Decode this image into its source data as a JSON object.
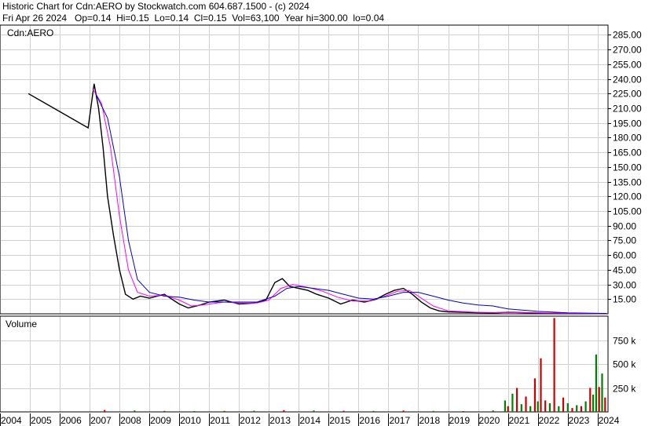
{
  "header": {
    "title_line": "Historic Chart for Cdn:AERO by Stockwatch.com 604.687.1500 - (c) 2024",
    "quote_line": "Fri Apr 26 2024   Op=0.14  Hi=0.15  Lo=0.14  Cl=0.15  Vol=63,100  Year hi=300.00  lo=0.04"
  },
  "chart_data": [
    {
      "type": "candlestick",
      "symbol_label": "Cdn:AERO",
      "ylim": [
        0,
        295
      ],
      "y_ticks": [
        "15.00",
        "30.00",
        "45.00",
        "60.00",
        "75.00",
        "90.00",
        "105.00",
        "120.00",
        "135.00",
        "150.00",
        "165.00",
        "180.00",
        "195.00",
        "210.00",
        "225.00",
        "240.00",
        "255.00",
        "270.00",
        "285.00"
      ],
      "grid": true,
      "series": [
        {
          "key": "price",
          "color": "#000000",
          "x": [
            2004.95,
            2006.95,
            2007.15,
            2007.3,
            2007.45,
            2007.6,
            2007.8,
            2008.0,
            2008.2,
            2008.45,
            2008.7,
            2009.0,
            2009.5,
            2010.0,
            2010.3,
            2010.7,
            2011.0,
            2011.5,
            2012.0,
            2012.5,
            2012.9,
            2013.2,
            2013.45,
            2013.7,
            2014.0,
            2014.3,
            2014.6,
            2015.0,
            2015.4,
            2015.8,
            2016.2,
            2016.6,
            2016.9,
            2017.2,
            2017.5,
            2017.8,
            2018.1,
            2018.4,
            2018.7,
            2019.0,
            2019.5,
            2020.0,
            2020.5,
            2021.0,
            2021.5,
            2022.0,
            2022.5,
            2023.0,
            2023.5,
            2024.0,
            2024.3
          ],
          "y": [
            225,
            190,
            235,
            210,
            170,
            120,
            80,
            45,
            20,
            15,
            18,
            16,
            20,
            10,
            6,
            9,
            12,
            14,
            10,
            11,
            14,
            32,
            36,
            28,
            26,
            24,
            20,
            16,
            10,
            14,
            12,
            15,
            20,
            24,
            26,
            20,
            12,
            6,
            3,
            2,
            1.5,
            1.2,
            1.0,
            1.5,
            1.2,
            0.8,
            0.6,
            0.5,
            0.3,
            0.2,
            0.15
          ]
        },
        {
          "key": "ma_short",
          "color": "#ff00ff",
          "x": [
            2007.1,
            2007.4,
            2007.7,
            2008.0,
            2008.3,
            2008.6,
            2009.0,
            2009.5,
            2010.0,
            2010.4,
            2010.8,
            2011.5,
            2012.0,
            2012.6,
            2013.0,
            2013.4,
            2013.8,
            2014.3,
            2014.8,
            2015.3,
            2015.8,
            2016.3,
            2016.8,
            2017.3,
            2017.7,
            2018.1,
            2018.5,
            2019.0,
            2020.0,
            2021.0,
            2022.0,
            2023.0,
            2024.3
          ],
          "y": [
            230,
            215,
            170,
            100,
            45,
            22,
            18,
            19,
            14,
            8,
            9,
            12,
            11,
            11,
            14,
            26,
            30,
            27,
            23,
            17,
            13,
            13,
            17,
            23,
            24,
            16,
            8,
            3,
            1.5,
            1.3,
            0.9,
            0.5,
            0.2
          ]
        },
        {
          "key": "ma_long",
          "color": "#0000cc",
          "x": [
            2007.2,
            2007.6,
            2008.0,
            2008.3,
            2008.6,
            2009.0,
            2009.5,
            2010.0,
            2010.5,
            2011.0,
            2011.5,
            2012.0,
            2012.6,
            2013.2,
            2013.6,
            2014.0,
            2014.5,
            2015.0,
            2015.5,
            2016.0,
            2016.5,
            2017.0,
            2017.5,
            2018.0,
            2018.5,
            2019.0,
            2019.5,
            2020.0,
            2020.5,
            2021.0,
            2022.0,
            2023.0,
            2024.3
          ],
          "y": [
            225,
            200,
            140,
            75,
            35,
            22,
            18,
            17,
            14,
            12,
            12,
            12,
            12,
            18,
            26,
            28,
            26,
            24,
            20,
            16,
            15,
            18,
            22,
            22,
            18,
            14,
            11,
            9,
            8,
            5,
            2.5,
            1,
            0.4
          ]
        }
      ]
    },
    {
      "type": "bar",
      "title": "Volume",
      "ylim": [
        0,
        1000
      ],
      "y_ticks": [
        "250 k",
        "500 k",
        "750 k"
      ],
      "grid": true,
      "x": [
        2007.5,
        2008.5,
        2009.5,
        2010.5,
        2011.5,
        2012.5,
        2013.5,
        2014.5,
        2015.5,
        2016.5,
        2017.5,
        2018.5,
        2019.5,
        2020.5,
        2020.9,
        2021.0,
        2021.15,
        2021.3,
        2021.45,
        2021.6,
        2021.75,
        2021.9,
        2022.0,
        2022.1,
        2022.25,
        2022.4,
        2022.55,
        2022.7,
        2022.85,
        2023.0,
        2023.15,
        2023.3,
        2023.45,
        2023.6,
        2023.75,
        2023.85,
        2023.95,
        2024.05,
        2024.15,
        2024.25
      ],
      "values": [
        20,
        15,
        10,
        8,
        10,
        12,
        18,
        15,
        12,
        10,
        14,
        10,
        8,
        15,
        120,
        60,
        190,
        250,
        80,
        160,
        60,
        350,
        110,
        560,
        120,
        90,
        980,
        60,
        150,
        90,
        40,
        70,
        60,
        110,
        250,
        180,
        600,
        260,
        400,
        150
      ],
      "colors": [
        "#cc0000",
        "#008000",
        "#cc0000",
        "#008000",
        "#cc0000",
        "#008000",
        "#cc0000",
        "#008000",
        "#cc0000",
        "#008000",
        "#cc0000",
        "#008000",
        "#cc0000",
        "#008000",
        "#008000",
        "#cc0000",
        "#008000",
        "#cc0000",
        "#008000",
        "#cc0000",
        "#008000",
        "#cc0000",
        "#008000",
        "#cc0000",
        "#cc0000",
        "#008000",
        "#cc0000",
        "#008000",
        "#cc0000",
        "#008000",
        "#cc0000",
        "#008000",
        "#cc0000",
        "#008000",
        "#cc0000",
        "#008000",
        "#008000",
        "#cc0000",
        "#008000",
        "#cc0000"
      ]
    },
    {
      "type": "time_axis",
      "categories": [
        "2004",
        "2005",
        "2006",
        "2007",
        "2008",
        "2009",
        "2010",
        "2011",
        "2012",
        "2013",
        "2014",
        "2015",
        "2016",
        "2017",
        "2018",
        "2019",
        "2020",
        "2021",
        "2022",
        "2023",
        "2024"
      ],
      "xlim": [
        2004.0,
        2024.35
      ]
    }
  ]
}
